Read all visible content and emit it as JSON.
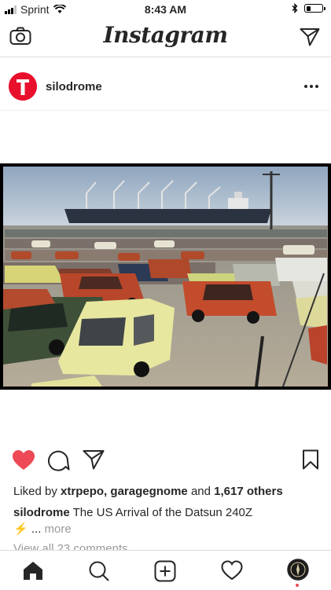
{
  "status_bar": {
    "carrier": "Sprint",
    "time": "8:43 AM",
    "battery_level": 0.3
  },
  "top_nav": {
    "logo_text": "Instagram",
    "left_icon": "camera-icon",
    "right_icon": "direct-message-icon"
  },
  "post": {
    "username": "silodrome",
    "more_icon": "more-options-icon",
    "image_icon": "post-photo",
    "actions": [
      "heart-icon-liked",
      "comment-icon",
      "share-icon",
      "bookmark-icon"
    ],
    "likes": {
      "prefix": "Liked by",
      "user1": "xtrpepo,",
      "user2": "garagegnome",
      "connector": "and",
      "others": "1,617 others"
    },
    "caption": {
      "username": "silodrome",
      "text": "The US Arrival of the Datsun 240Z",
      "emoji": "⚡",
      "ellipsis": "...",
      "more": "more"
    },
    "comments_link": "View all 23 comments"
  },
  "tab_bar": {
    "items": [
      "home-icon",
      "search-icon",
      "new-post-icon",
      "activity-icon",
      "profile-avatar"
    ]
  },
  "colors": {
    "heart": "#ed4956",
    "avatar_red": "#e8102c",
    "divider": "#dbdbdb"
  }
}
